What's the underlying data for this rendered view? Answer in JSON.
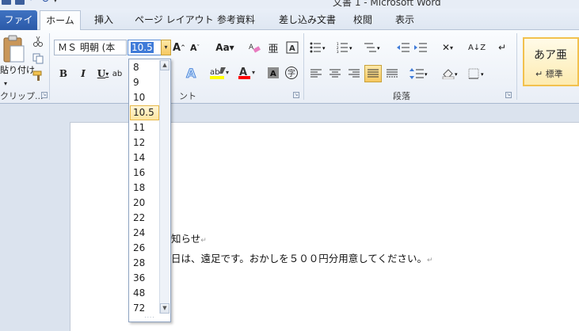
{
  "window": {
    "title": "文書 1 - Microsoft Word"
  },
  "tabs": {
    "file": "ファイル",
    "home": "ホーム",
    "insert": "挿入",
    "page_layout": "ページ レイアウト",
    "references": "参考資料",
    "mailings": "差し込み文書",
    "review": "校閲",
    "view": "表示"
  },
  "clipboard": {
    "paste_label": "貼り付け",
    "group_label": "クリップ..."
  },
  "font": {
    "name": "ＭＳ 明朝 (本",
    "size": "10.5",
    "group_label": "ント"
  },
  "paragraph": {
    "group_label": "段落"
  },
  "styles": {
    "sample": "あア亜",
    "name": "標準"
  },
  "size_dropdown": {
    "items": [
      "8",
      "9",
      "10",
      "10.5",
      "11",
      "12",
      "14",
      "16",
      "18",
      "20",
      "22",
      "24",
      "26",
      "28",
      "36",
      "48",
      "72"
    ],
    "selected": "10.5"
  },
  "document": {
    "line1": "知らせ",
    "line2": "日は、遠足です。おかしを５００円分用意してください。",
    "return_mark": "↵"
  },
  "colors": {
    "file_tab": "#2b5aa8",
    "highlight": "#ffff00",
    "font_color": "#ff0000",
    "selection": "#fde6a0"
  }
}
